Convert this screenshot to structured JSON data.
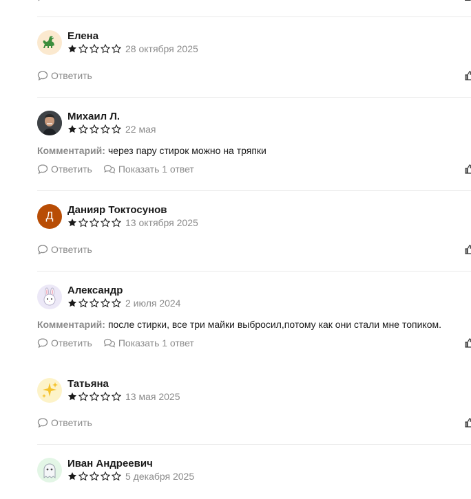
{
  "comment_label": "Комментарий:",
  "reply_label": "Ответить",
  "colors": {
    "star": "#1a1a1a",
    "muted": "#8a8a8a",
    "divider": "#e9e9e9"
  },
  "reviews": [
    {
      "name": "Елена",
      "avatar_icon": "dinosaur-icon",
      "avatar_bg": "#fbe9cf",
      "rating": 1,
      "date": "28 октября 2025",
      "comment": "",
      "show_replies": ""
    },
    {
      "name": "Михаил Л.",
      "avatar_icon": "person-photo-icon",
      "avatar_bg": "#4b4f54",
      "rating": 1,
      "date": "22 мая",
      "comment": "через пару стирок можно на тряпки",
      "show_replies": "Показать 1 ответ"
    },
    {
      "name": "Данияр Токтосунов",
      "avatar_letter": "Д",
      "avatar_bg": "#b84d05",
      "rating": 1,
      "date": "13 октября 2025",
      "comment": "",
      "show_replies": ""
    },
    {
      "name": "Александр",
      "avatar_icon": "rabbit-icon",
      "avatar_bg": "#ece8f7",
      "rating": 1,
      "date": "2 июля 2024",
      "comment": "после стирки, все три майки выбросил,потому как они стали мне топиком.",
      "show_replies": "Показать 1 ответ"
    },
    {
      "name": "Татьяна",
      "avatar_icon": "sparkles-icon",
      "avatar_bg": "#fdf3c8",
      "rating": 1,
      "date": "13 мая 2025",
      "comment": "",
      "show_replies": ""
    },
    {
      "name": "Иван Андреевич",
      "avatar_icon": "ghost-icon",
      "avatar_bg": "#e3f6e6",
      "rating": 1,
      "date": "5 декабря 2025",
      "comment": "",
      "show_replies": ""
    }
  ]
}
